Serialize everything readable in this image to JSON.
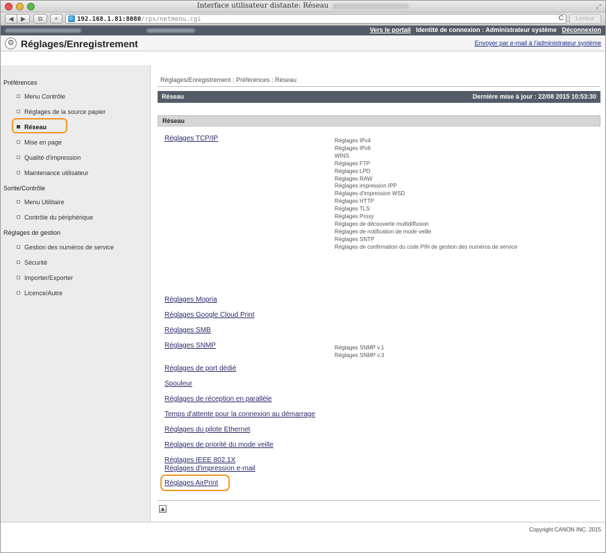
{
  "window": {
    "title": "Interface utilisateur distante: Réseau"
  },
  "toolbar": {
    "back": "◀",
    "forward": "▶",
    "bookmarks": "⧉",
    "add": "+",
    "url_host": "192.168.1.81:8080",
    "url_path": "/rps/netmenu.cgi",
    "reload": "C",
    "reader": "Lecteur"
  },
  "userbar": {
    "portal_link": "Vers le portail",
    "login_label": "Identité de connexion : Administrateur système",
    "logout_link": "Déconnexion"
  },
  "header": {
    "logo_icon": "gear-icon",
    "title": "Réglages/Enregistrement",
    "email_admin": "Envoyer par e-mail à l'administrateur système"
  },
  "sidebar": {
    "sections": [
      {
        "label": "Préférences",
        "items": [
          {
            "label": "Menu Contrôle",
            "active": false
          },
          {
            "label": "Réglages de la source papier",
            "active": false
          },
          {
            "label": "Réseau",
            "active": true
          },
          {
            "label": "Mise en page",
            "active": false
          },
          {
            "label": "Qualité d'impression",
            "active": false
          },
          {
            "label": "Maintenance utilisateur",
            "active": false
          }
        ]
      },
      {
        "label": "Sortie/Contrôle",
        "items": [
          {
            "label": "Menu Utilitaire",
            "active": false
          },
          {
            "label": "Contrôle du périphérique",
            "active": false
          }
        ]
      },
      {
        "label": "Réglages de gestion",
        "items": [
          {
            "label": "Gestion des numéros de service",
            "active": false
          },
          {
            "label": "Sécurité",
            "active": false
          },
          {
            "label": "Importer/Exporter",
            "active": false
          },
          {
            "label": "Licence/Autre",
            "active": false
          }
        ]
      }
    ]
  },
  "main": {
    "breadcrumb": "Réglages/Enregistrement : Préférences : Réseau",
    "panel_title": "Réseau",
    "last_updated": "Dernière mise à jour : 22/08 2015 10:53:30",
    "subheader": "Réseau",
    "settings": [
      {
        "label": "Réglages TCP/IP",
        "sub": [
          "Réglages IPv4",
          "Réglages IPv6",
          "WINS",
          "Réglages FTP",
          "Réglages LPD",
          "Réglages RAW",
          "Réglages impression IPP",
          "Réglages d'impression WSD",
          "Réglages HTTP",
          "Réglages TLS",
          "Réglages Proxy",
          "Réglages de découverte multidiffusion",
          "Réglages de notification de mode veille",
          "Réglages SNTP",
          "Réglages de confirmation du code PIN de gestion des numéros de service"
        ]
      },
      {
        "label": "Réglages Mopria",
        "sub": []
      },
      {
        "label": "Réglages Google Cloud Print",
        "sub": []
      },
      {
        "label": "Réglages SMB",
        "sub": []
      },
      {
        "label": "Réglages SNMP",
        "sub": [
          "Réglages SNMP v.1",
          "Réglages SNMP v.3"
        ]
      },
      {
        "label": "Réglages de port dédié",
        "sub": []
      },
      {
        "label": "Spouleur",
        "sub": []
      },
      {
        "label": "Réglages de réception en parallèle",
        "sub": []
      },
      {
        "label": "Temps d'attente pour la connexion au démarrage",
        "sub": []
      },
      {
        "label": "Réglages du pilote Ethernet",
        "sub": []
      },
      {
        "label": "Réglages de priorité du mode veille",
        "sub": []
      },
      {
        "label": "Réglages IEEE 802.1X",
        "sub": []
      },
      {
        "label": "Réglages d'impression e-mail",
        "sub": []
      },
      {
        "label": "Réglages AirPrint",
        "sub": []
      }
    ],
    "top_button": "▲"
  },
  "footer": {
    "copyright": "Copyright CANON INC. 2015"
  },
  "colors": {
    "highlight": "#f0992a",
    "header_bar": "#545c67",
    "link": "#2a2a6a"
  }
}
